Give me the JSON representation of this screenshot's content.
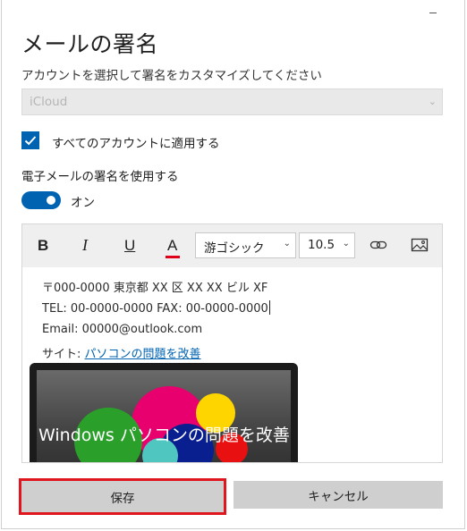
{
  "dialog": {
    "title": "メールの署名",
    "account_label": "アカウントを選択して署名をカスタマイズしてください",
    "account_value": "iCloud",
    "apply_all_label": "すべてのアカウントに適用する",
    "apply_all_checked": true,
    "use_signature_label": "電子メールの署名を使用する",
    "toggle_state": "オン",
    "toggle_on": true
  },
  "toolbar": {
    "bold": "B",
    "italic": "I",
    "underline": "U",
    "font_color": "A",
    "font_color_hex": "#e0001a",
    "font_family": "游ゴシック",
    "font_size": "10.5",
    "link_icon": "link-icon",
    "image_icon": "image-icon"
  },
  "signature": {
    "lines": [
      "〒000-0000 東京都 XX 区 XX XX ビル XF",
      "TEL: 00-0000-0000 FAX: 00-0000-0000",
      "Email: 00000@outlook.com"
    ],
    "site_label": "サイト:",
    "site_link": "パソコンの問題を改善",
    "banner_text": "Windows パソコンの問題を改善"
  },
  "buttons": {
    "save": "保存",
    "cancel": "キャンセル"
  },
  "colors": {
    "accent": "#0063b1",
    "highlight_border": "#e0161e"
  }
}
